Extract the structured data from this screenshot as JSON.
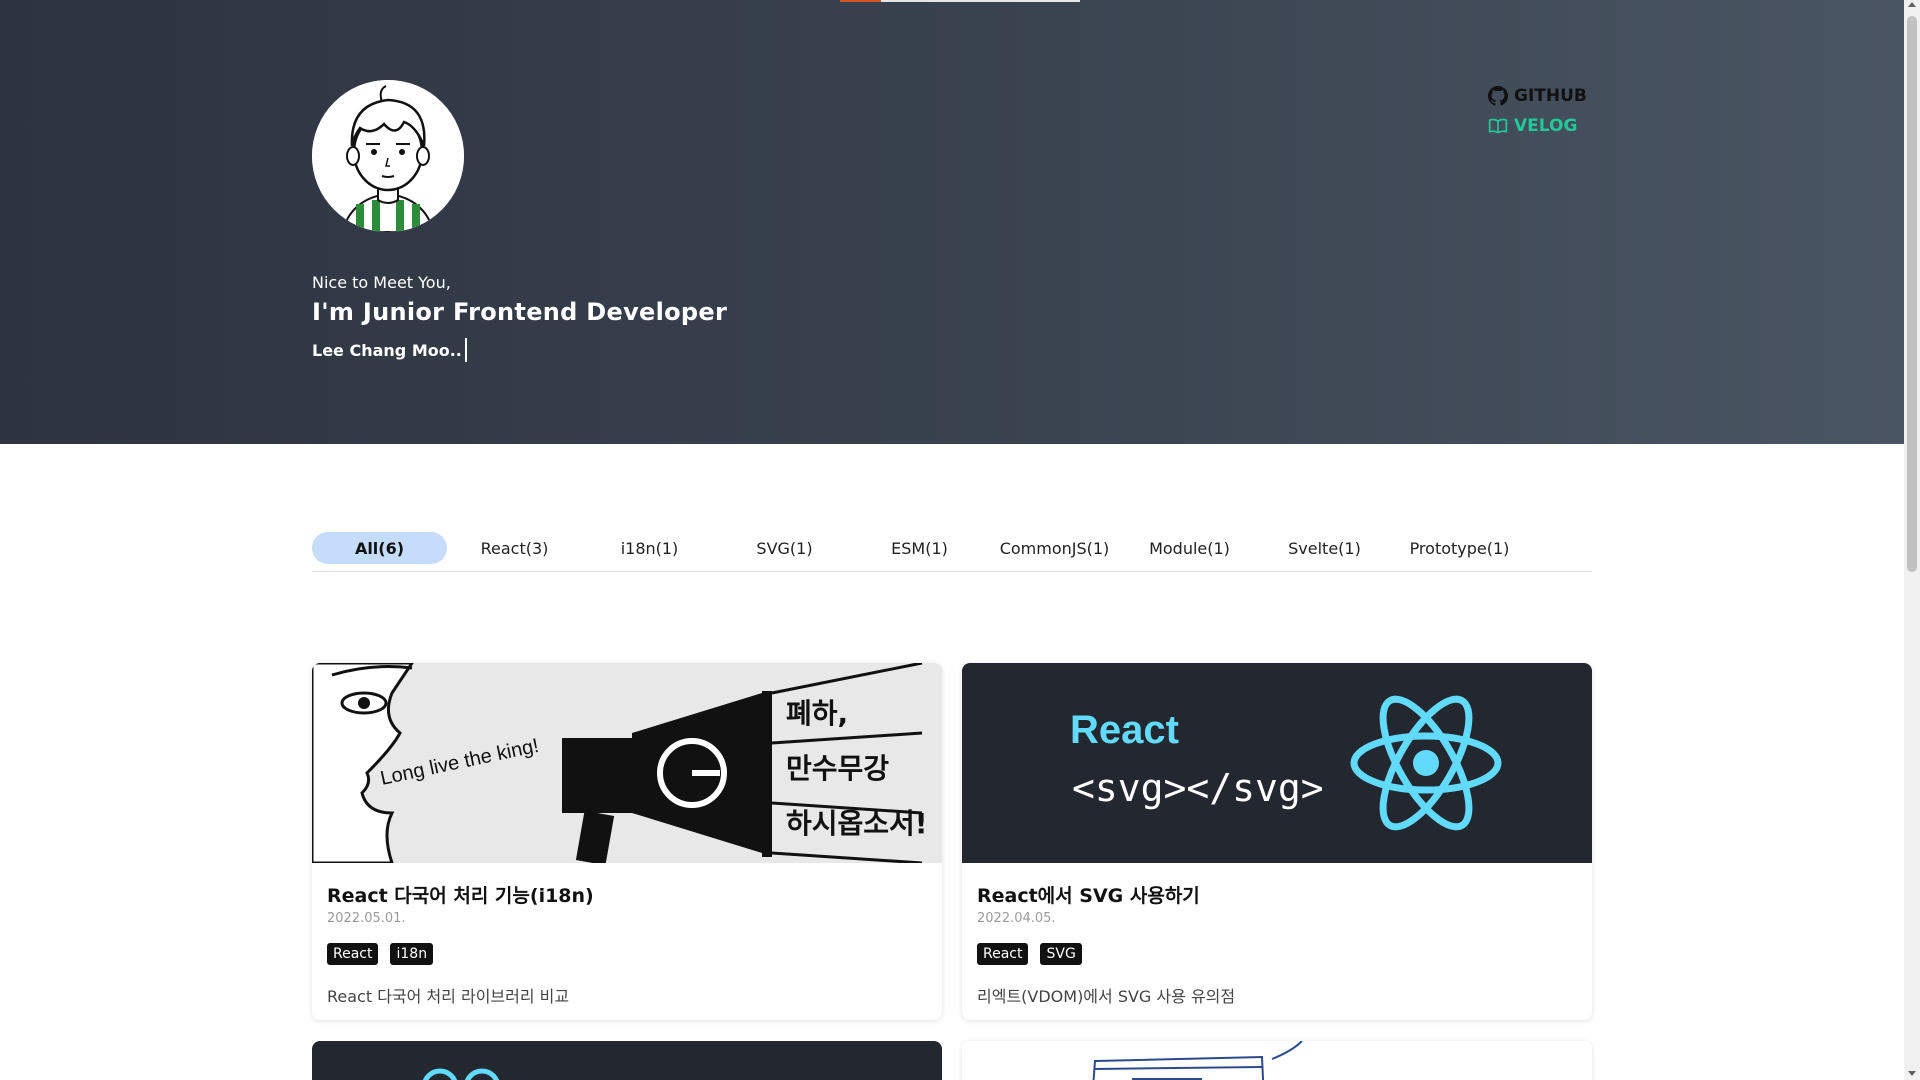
{
  "hero": {
    "greeting": "Nice to Meet You,",
    "headline": "I'm Junior Frontend Developer",
    "typed_name": "Lee Chang Moo..",
    "reading_progress": 0.17
  },
  "social": {
    "github_label": "GITHUB",
    "velog_label": "VELOG"
  },
  "colors": {
    "hero_start": "#2d3440",
    "hero_end": "#4a5563",
    "velog_green": "#20c997",
    "active_tab_bg": "#c5dcfa",
    "progress_orange": "#d0542a",
    "react_blue": "#61dafb"
  },
  "tabs": [
    {
      "label": "All(6)",
      "active": true
    },
    {
      "label": "React(3)"
    },
    {
      "label": "i18n(1)"
    },
    {
      "label": "SVG(1)"
    },
    {
      "label": "ESM(1)"
    },
    {
      "label": "CommonJS(1)"
    },
    {
      "label": "Module(1)"
    },
    {
      "label": "Svelte(1)"
    },
    {
      "label": "Prototype(1)"
    }
  ],
  "posts": [
    {
      "title": "React 다국어 처리 기능(i18n)",
      "date": "2022.05.01.",
      "tags": [
        "React",
        "i18n"
      ],
      "description": "React 다국어 처리 라이브러리 비교",
      "thumb": {
        "speech": "Long live the king!",
        "lines": [
          "폐하,",
          "만수무강",
          "하시옵소서!"
        ]
      }
    },
    {
      "title": "React에서 SVG 사용하기",
      "date": "2022.04.05.",
      "tags": [
        "React",
        "SVG"
      ],
      "description": "리엑트(VDOM)에서 SVG 사용 유의점",
      "thumb": {
        "heading": "React",
        "code": "<svg></svg>"
      }
    }
  ]
}
